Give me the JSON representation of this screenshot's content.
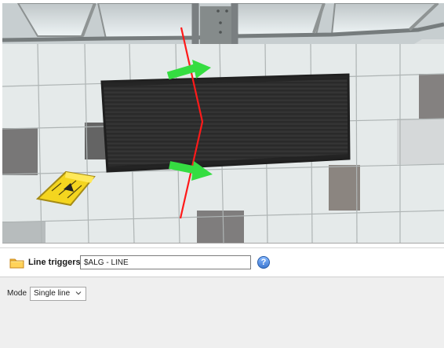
{
  "line_triggers": {
    "label": "Line triggers",
    "value": "$ALG - LINE"
  },
  "mode": {
    "label": "Mode",
    "selected": "Single line"
  },
  "icons": {
    "folder": "folder-icon",
    "help": "help-icon",
    "dropdown": "chevron-down-icon"
  },
  "colors": {
    "trigger_line": "#ff1a1a",
    "direction_arrows": "#35dd41",
    "help_accent": "#3f79d1",
    "settings_background": "#efefef"
  }
}
